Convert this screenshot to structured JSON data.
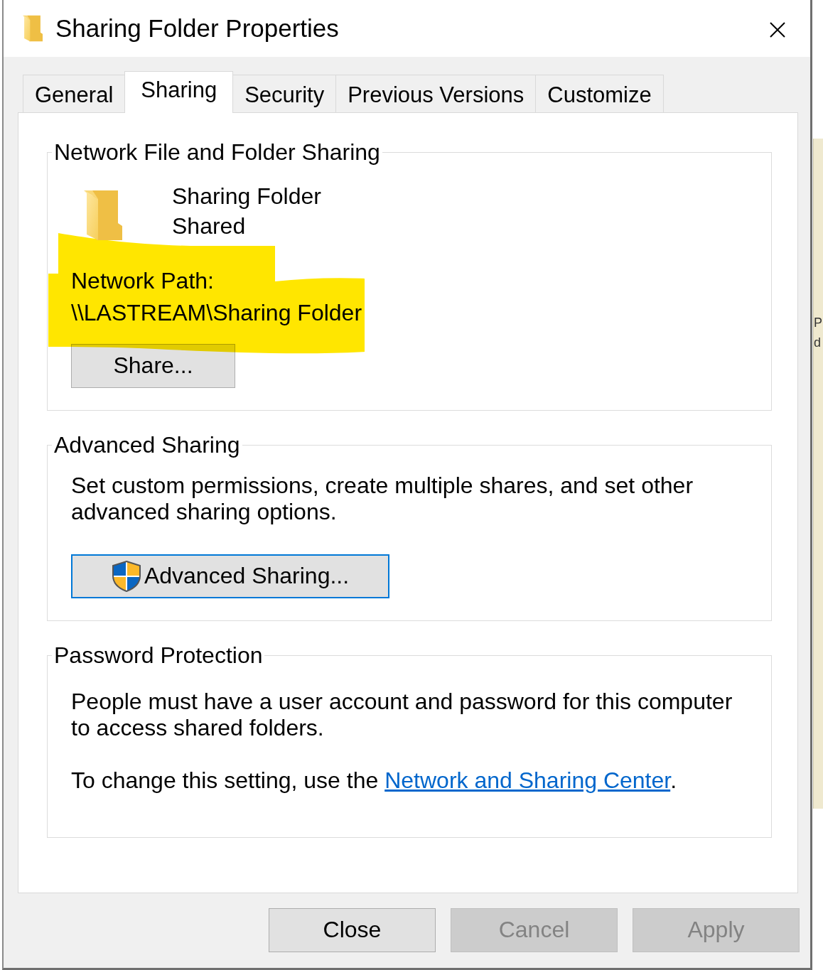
{
  "window": {
    "title": "Sharing Folder Properties"
  },
  "tabs": [
    {
      "label": "General",
      "selected": false
    },
    {
      "label": "Sharing",
      "selected": true
    },
    {
      "label": "Security",
      "selected": false
    },
    {
      "label": "Previous Versions",
      "selected": false
    },
    {
      "label": "Customize",
      "selected": false
    }
  ],
  "network_sharing": {
    "title": "Network File and Folder Sharing",
    "folder_name": "Sharing Folder",
    "status": "Shared",
    "path_label": "Network Path:",
    "path": "\\\\LASTREAM\\Sharing Folder",
    "highlighted": true,
    "button": {
      "label": "Share..."
    }
  },
  "advanced_sharing": {
    "title": "Advanced Sharing",
    "description": "Set custom permissions, create multiple shares, and set other advanced sharing options.",
    "button": {
      "label": "Advanced Sharing...",
      "focused": true
    }
  },
  "password_protection": {
    "title": "Password Protection",
    "description": "People must have a user account and password for this computer to access shared folders.",
    "note": "To change this setting, use the ",
    "link": "Network and Sharing Center",
    "note_end": "."
  },
  "buttons": [
    {
      "label": "Close",
      "disabled": false
    },
    {
      "label": "Cancel",
      "disabled": true
    },
    {
      "label": "Apply",
      "disabled": true
    }
  ],
  "background_window": {
    "texts": [
      "P",
      "d"
    ]
  }
}
